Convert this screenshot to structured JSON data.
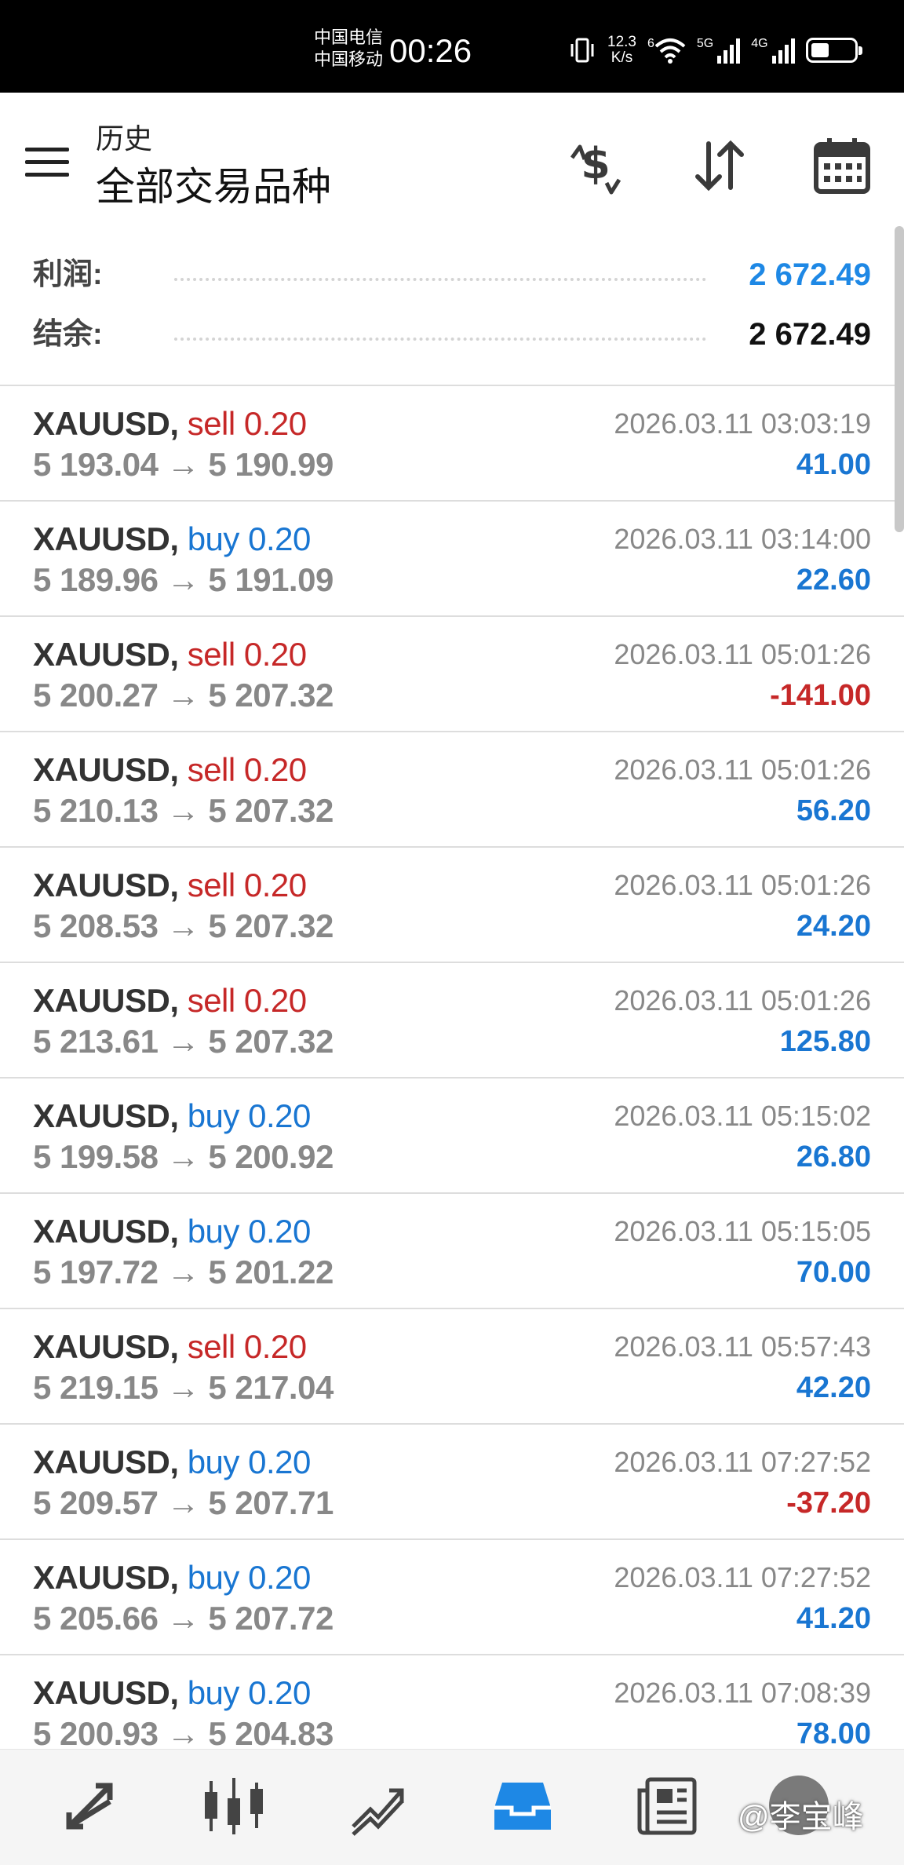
{
  "status_bar": {
    "carrier1": "中国电信",
    "carrier2": "中国移动",
    "time": "00:26",
    "net_speed_value": "12.3",
    "net_speed_unit": "K/s",
    "wifi_badge": "6",
    "signal1_label": "5G",
    "signal2_label": "4G"
  },
  "header": {
    "subtitle": "历史",
    "title": "全部交易品种",
    "icons": [
      "currency-exchange-icon",
      "sort-icon",
      "calendar-icon"
    ]
  },
  "summary": {
    "profit_label": "利润:",
    "profit_value": "2 672.49",
    "balance_label": "结余:",
    "balance_value": "2 672.49"
  },
  "colors": {
    "sell": "#c62828",
    "buy": "#1976d2",
    "profit_positive": "#1976d2",
    "profit_negative": "#c62828",
    "accent": "#1e88e5"
  },
  "trades": [
    {
      "symbol": "XAUUSD,",
      "side": "sell",
      "volume": "0.20",
      "prices": "5 193.04 → 5 190.99",
      "time": "2026.03.11 03:03:19",
      "profit": "41.00"
    },
    {
      "symbol": "XAUUSD,",
      "side": "buy",
      "volume": "0.20",
      "prices": "5 189.96 → 5 191.09",
      "time": "2026.03.11 03:14:00",
      "profit": "22.60"
    },
    {
      "symbol": "XAUUSD,",
      "side": "sell",
      "volume": "0.20",
      "prices": "5 200.27 → 5 207.32",
      "time": "2026.03.11 05:01:26",
      "profit": "-141.00"
    },
    {
      "symbol": "XAUUSD,",
      "side": "sell",
      "volume": "0.20",
      "prices": "5 210.13 → 5 207.32",
      "time": "2026.03.11 05:01:26",
      "profit": "56.20"
    },
    {
      "symbol": "XAUUSD,",
      "side": "sell",
      "volume": "0.20",
      "prices": "5 208.53 → 5 207.32",
      "time": "2026.03.11 05:01:26",
      "profit": "24.20"
    },
    {
      "symbol": "XAUUSD,",
      "side": "sell",
      "volume": "0.20",
      "prices": "5 213.61 → 5 207.32",
      "time": "2026.03.11 05:01:26",
      "profit": "125.80"
    },
    {
      "symbol": "XAUUSD,",
      "side": "buy",
      "volume": "0.20",
      "prices": "5 199.58 → 5 200.92",
      "time": "2026.03.11 05:15:02",
      "profit": "26.80"
    },
    {
      "symbol": "XAUUSD,",
      "side": "buy",
      "volume": "0.20",
      "prices": "5 197.72 → 5 201.22",
      "time": "2026.03.11 05:15:05",
      "profit": "70.00"
    },
    {
      "symbol": "XAUUSD,",
      "side": "sell",
      "volume": "0.20",
      "prices": "5 219.15 → 5 217.04",
      "time": "2026.03.11 05:57:43",
      "profit": "42.20"
    },
    {
      "symbol": "XAUUSD,",
      "side": "buy",
      "volume": "0.20",
      "prices": "5 209.57 → 5 207.71",
      "time": "2026.03.11 07:27:52",
      "profit": "-37.20"
    },
    {
      "symbol": "XAUUSD,",
      "side": "buy",
      "volume": "0.20",
      "prices": "5 205.66 → 5 207.72",
      "time": "2026.03.11 07:27:52",
      "profit": "41.20"
    },
    {
      "symbol": "XAUUSD,",
      "side": "buy",
      "volume": "0.20",
      "prices": "5 200.93 → 5 204.83",
      "time": "2026.03.11 07:08:39",
      "profit": "78.00"
    }
  ],
  "bottom_nav": {
    "items": [
      "quotes-icon",
      "chart-candles-icon",
      "trade-icon",
      "history-inbox-icon",
      "news-icon"
    ],
    "active": "history-inbox-icon",
    "watermark": "@李宝峰"
  }
}
